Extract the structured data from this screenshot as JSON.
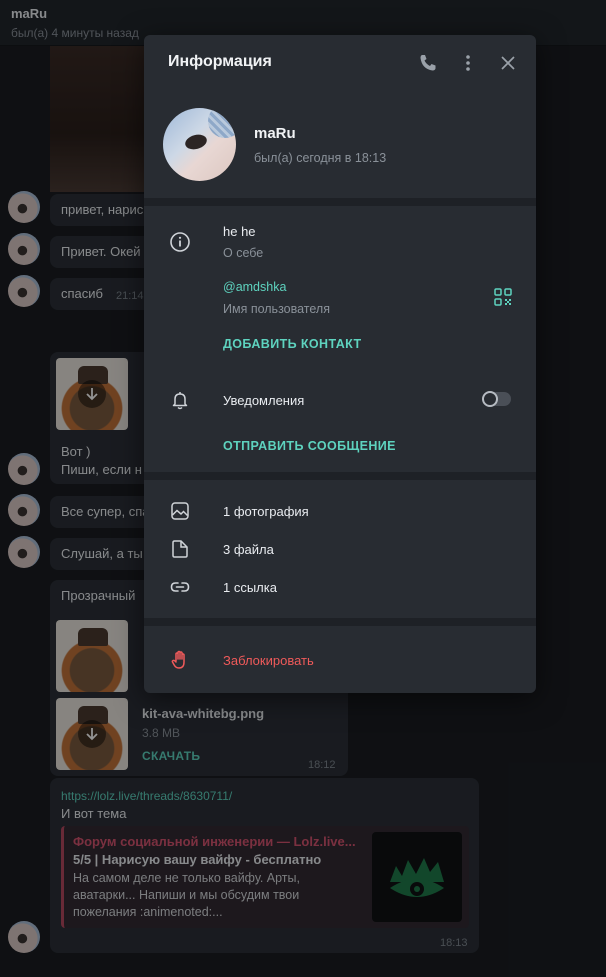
{
  "chat": {
    "name": "maRu",
    "status": "был(а) 4 минуты назад",
    "messages": [
      {
        "text": "привет, нарис",
        "time": ""
      },
      {
        "text": "Привет. Окей",
        "time": ""
      },
      {
        "text": "спасиб",
        "time": "21:14"
      },
      {
        "text": "Вот )",
        "time": ""
      },
      {
        "text": "Пиши, если н",
        "time": ""
      },
      {
        "text": "Все супер, спа",
        "time": ""
      },
      {
        "text": "Слушай, а ты",
        "time": ""
      },
      {
        "text": "Прозрачный",
        "time": ""
      }
    ],
    "file": {
      "name": "kit-ava-whitebg.png",
      "size": "3.8 MB",
      "download": "СКАЧАТЬ",
      "time": "18:12"
    },
    "link_message": {
      "url": "https://lolz.live/threads/8630711/",
      "text": "И вот тема",
      "preview_site": "Форум социальной инженерии — Lolz.live...",
      "preview_title": "5/5 | Нарисую вашу вайфу - бесплатно",
      "preview_desc": "На самом деле не только вайфу. Арты, аватарки... Напиши и мы обсудим твои пожелания :animenoted:...",
      "time": "18:13"
    }
  },
  "modal": {
    "title": "Информация",
    "header_icons": [
      "phone-icon",
      "more-vertical-icon",
      "close-icon"
    ],
    "profile": {
      "name": "maRu",
      "status": "был(а) сегодня в 18:13"
    },
    "bio": {
      "value": "he he",
      "label": "О себе"
    },
    "username": {
      "value": "@amdshka",
      "label": "Имя пользователя"
    },
    "add_contact": "ДОБАВИТЬ КОНТАКТ",
    "notifications": {
      "label": "Уведомления",
      "enabled": false
    },
    "send_message": "ОТПРАВИТЬ СООБЩЕНИЕ",
    "media": {
      "photos": "1 фотография",
      "files": "3 файла",
      "links": "1 ссылка"
    },
    "block": "Заблокировать"
  },
  "colors": {
    "accent": "#5ed3bf",
    "danger": "#ef5a5a",
    "modal_bg": "#282c32"
  }
}
